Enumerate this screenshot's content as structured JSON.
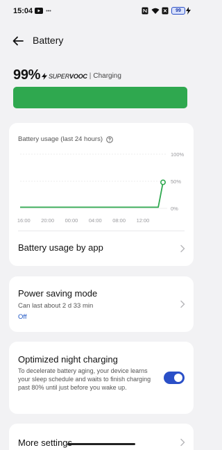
{
  "status_bar": {
    "time": "15:04",
    "left_icons": [
      "youtube-icon",
      "more-dots-icon"
    ],
    "right_icons": [
      "nfc-icon",
      "wifi-icon",
      "signal-x-icon",
      "battery-icon"
    ],
    "battery_level": "99"
  },
  "header": {
    "title": "Battery"
  },
  "battery": {
    "percent": "99%",
    "charge_brand_prefix": "SUPER",
    "charge_brand_suffix": "VOOC",
    "separator": "|",
    "status": "Charging",
    "bar_color": "#2fa84f",
    "fill_fraction": 0.99
  },
  "usage": {
    "title": "Battery usage (last 24 hours)"
  },
  "chart_data": {
    "type": "line",
    "x_ticks": [
      "16:00",
      "20:00",
      "00:00",
      "04:00",
      "08:00",
      "12:00"
    ],
    "y_ticks": [
      "100%",
      "50%",
      "0%"
    ],
    "ylim": [
      0,
      100
    ],
    "series": [
      {
        "x": [
          15.5,
          16,
          20,
          24,
          28,
          32,
          36,
          38.7,
          39.5
        ],
        "y": [
          2,
          2,
          2,
          2,
          2,
          2,
          2,
          2,
          48
        ]
      }
    ],
    "line_color": "#2fa84f",
    "grid": true
  },
  "rows": {
    "usage_by_app": "Battery usage by app",
    "power_saving": {
      "title": "Power saving mode",
      "subtitle": "Can last about 2 d 33 min",
      "state": "Off"
    },
    "night_charging": {
      "title": "Optimized night charging",
      "description": "To decelerate battery aging, your device learns your sleep schedule and waits to finish charging past 80% until just before you wake up.",
      "enabled": true
    },
    "more_settings": "More settings"
  },
  "colors": {
    "accent": "#2a4fc7",
    "link": "#1d55c4",
    "background": "#f2f2f4"
  }
}
